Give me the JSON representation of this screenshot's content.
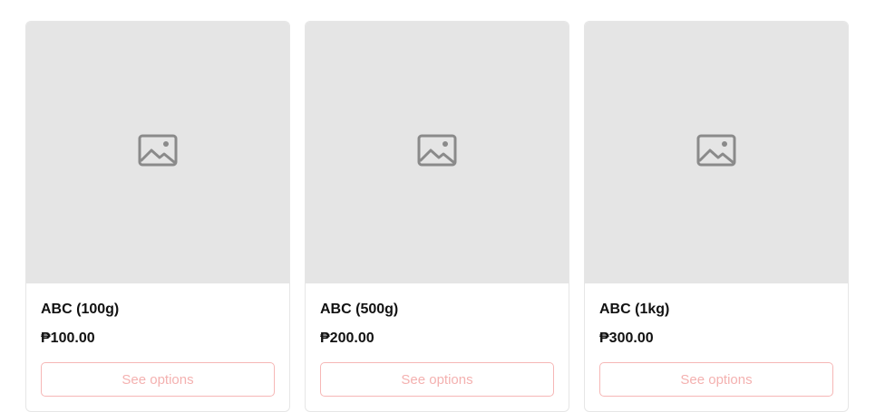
{
  "products": [
    {
      "title": "ABC (100g)",
      "price": "₱100.00",
      "button_label": "See options",
      "image_icon": "image-placeholder-icon"
    },
    {
      "title": "ABC (500g)",
      "price": "₱200.00",
      "button_label": "See options",
      "image_icon": "image-placeholder-icon"
    },
    {
      "title": "ABC (1kg)",
      "price": "₱300.00",
      "button_label": "See options",
      "image_icon": "image-placeholder-icon"
    }
  ],
  "colors": {
    "placeholder_bg": "#e5e5e5",
    "button_border": "#f6b7b6",
    "button_text": "#f4b1b0",
    "title_text": "#111111"
  }
}
